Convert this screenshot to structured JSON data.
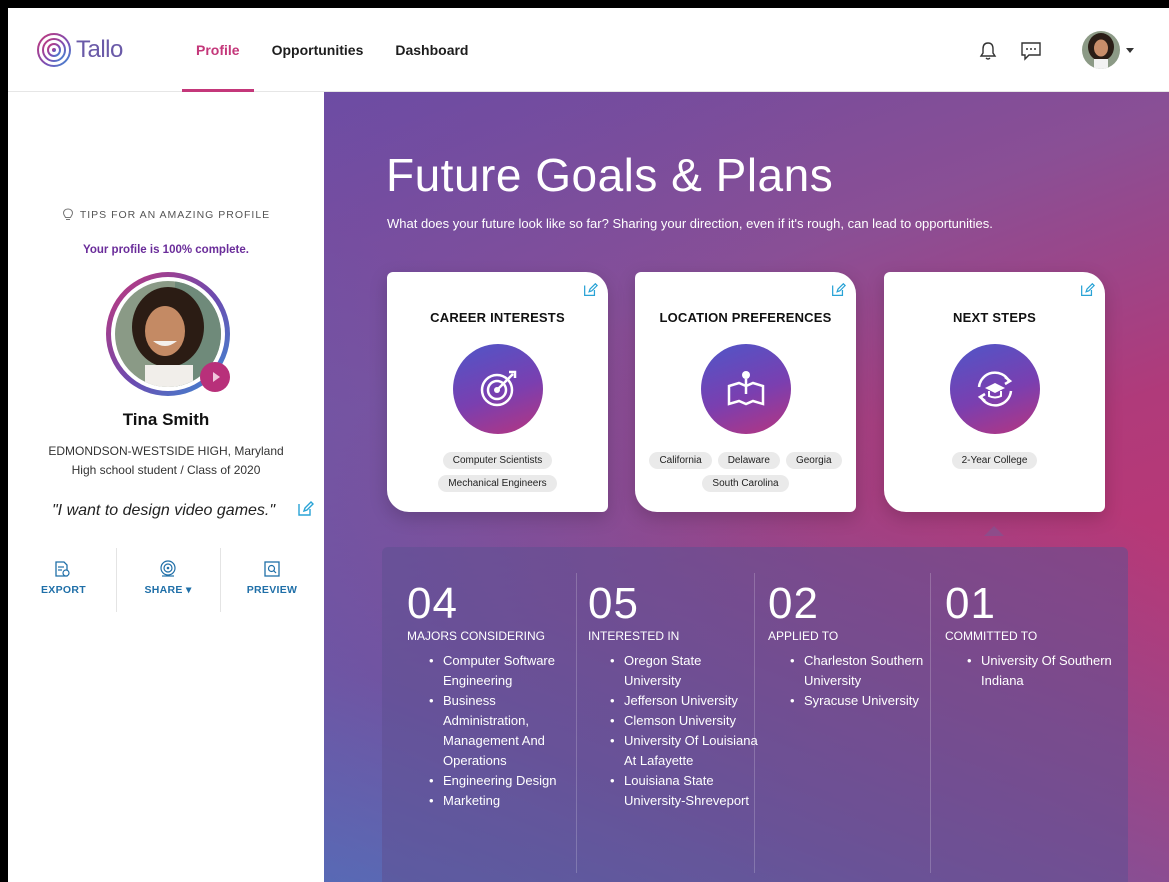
{
  "app": {
    "logo_text": "Tallo"
  },
  "nav": {
    "items": [
      "Profile",
      "Opportunities",
      "Dashboard"
    ],
    "active": "Profile"
  },
  "left": {
    "tips": "TIPS FOR AN AMAZING PROFILE",
    "completion": "Your profile is 100% complete.",
    "completion_percent": 100,
    "name": "Tina Smith",
    "school": "EDMONDSON-WESTSIDE HIGH, Maryland",
    "class_line": "High school student / Class of 2020",
    "quote": "\"I want to design video games.\"",
    "actions": {
      "export": "EXPORT",
      "share": "SHARE",
      "preview": "PREVIEW"
    }
  },
  "main": {
    "title": "Future Goals & Plans",
    "subtitle": "What does your future look like so far? Sharing your direction, even if it's rough, can lead to opportunities.",
    "cards": [
      {
        "title": "CAREER INTERESTS",
        "icon": "target-icon",
        "tags": [
          "Computer Scientists",
          "Mechanical Engineers"
        ]
      },
      {
        "title": "LOCATION PREFERENCES",
        "icon": "map-pin-icon",
        "tags": [
          "California",
          "Delaware",
          "Georgia",
          "South Carolina"
        ]
      },
      {
        "title": "NEXT STEPS",
        "icon": "graduation-refresh-icon",
        "tags": [
          "2-Year College"
        ]
      }
    ],
    "stats": [
      {
        "num": "04",
        "caption": "MAJORS CONSIDERING",
        "items": [
          "Computer Software Engineering",
          "Business Administration, Management And Operations",
          "Engineering Design",
          "Marketing"
        ]
      },
      {
        "num": "05",
        "caption": "INTERESTED IN",
        "items": [
          "Oregon State University",
          "Jefferson University",
          "Clemson University",
          "University Of Louisiana At Lafayette",
          "Louisiana State University-Shreveport"
        ]
      },
      {
        "num": "02",
        "caption": "APPLIED TO",
        "items": [
          "Charleston Southern University",
          "Syracuse University"
        ]
      },
      {
        "num": "01",
        "caption": "COMMITTED TO",
        "items": [
          "University Of Southern Indiana"
        ]
      }
    ]
  },
  "colors": {
    "accent": "#c4377a",
    "link": "#1f6fa8",
    "purple": "#6a2c9a"
  }
}
